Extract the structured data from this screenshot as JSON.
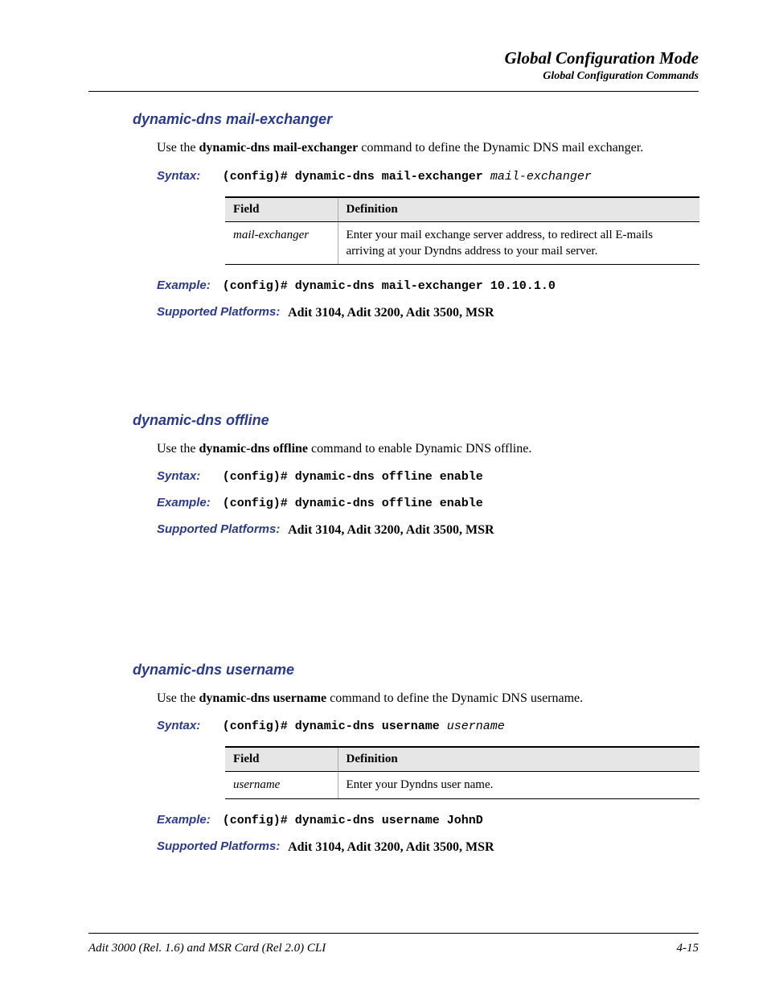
{
  "header": {
    "title": "Global Configuration Mode",
    "subtitle": "Global Configuration Commands"
  },
  "labels": {
    "syntax": "Syntax:",
    "example": "Example:",
    "supported": "Supported Platforms:",
    "field": "Field",
    "definition": "Definition"
  },
  "sections": [
    {
      "title": "dynamic-dns mail-exchanger",
      "desc_pre": "Use the ",
      "desc_bold": "dynamic-dns mail-exchanger",
      "desc_post": " command to define the Dynamic DNS mail exchanger.",
      "syntax_fixed": "(config)# dynamic-dns mail-exchanger ",
      "syntax_var": "mail-exchanger",
      "table": [
        {
          "field": "mail-exchanger",
          "def": "Enter your mail exchange server address, to redirect all E-mails arriving at your Dyndns address to your mail server."
        }
      ],
      "example": "(config)# dynamic-dns mail-exchanger 10.10.1.0",
      "platforms": "Adit 3104, Adit 3200, Adit 3500, MSR"
    },
    {
      "title": "dynamic-dns offline",
      "desc_pre": "Use the ",
      "desc_bold": "dynamic-dns offline",
      "desc_post": " command to enable Dynamic DNS offline.",
      "syntax_fixed": "(config)# dynamic-dns offline enable",
      "syntax_var": "",
      "table": [],
      "example": "(config)# dynamic-dns offline enable",
      "platforms": "Adit 3104, Adit 3200, Adit 3500, MSR"
    },
    {
      "title": "dynamic-dns username",
      "desc_pre": "Use the ",
      "desc_bold": "dynamic-dns username",
      "desc_post": " command to define the Dynamic DNS username.",
      "syntax_fixed": "(config)# dynamic-dns username ",
      "syntax_var": "username",
      "table": [
        {
          "field": "username",
          "def": "Enter your Dyndns user name."
        }
      ],
      "example": "(config)# dynamic-dns username JohnD",
      "platforms": "Adit 3104, Adit 3200, Adit 3500, MSR"
    }
  ],
  "footer": {
    "left": "Adit 3000 (Rel. 1.6) and MSR Card (Rel 2.0) CLI",
    "right": "4-15"
  }
}
